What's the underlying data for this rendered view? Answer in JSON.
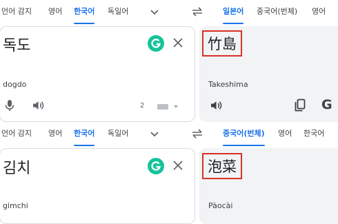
{
  "panel1": {
    "tabs": [
      "언어 감지",
      "영어",
      "한국어",
      "독일어"
    ],
    "active_source_tab": 2,
    "target_tabs": [
      "일본어",
      "중국어(번체)",
      "영어"
    ],
    "active_target_tab": 0,
    "source_text": "독도",
    "source_translit": "dogdo",
    "target_text": "竹島",
    "target_translit": "Takeshima",
    "char_count": "2",
    "target_g_letter": "G"
  },
  "panel2": {
    "tabs": [
      "언어 감지",
      "영어",
      "한국어",
      "독일어"
    ],
    "active_source_tab": 2,
    "target_tabs": [
      "중국어(번체)",
      "영어",
      "한국어"
    ],
    "active_target_tab": 0,
    "source_text": "김치",
    "source_translit": "gimchi",
    "target_text": "泡菜",
    "target_translit": "Pàocài"
  },
  "colors": {
    "accent": "#1a73e8",
    "highlight_box": "#d93025",
    "grammarly": "#15c39a"
  },
  "icons": [
    "chevron-down-icon",
    "swap-icon",
    "grammarly-icon",
    "close-icon",
    "mic-icon",
    "speaker-icon",
    "keyboard-icon",
    "copy-icon",
    "google-g-icon"
  ]
}
